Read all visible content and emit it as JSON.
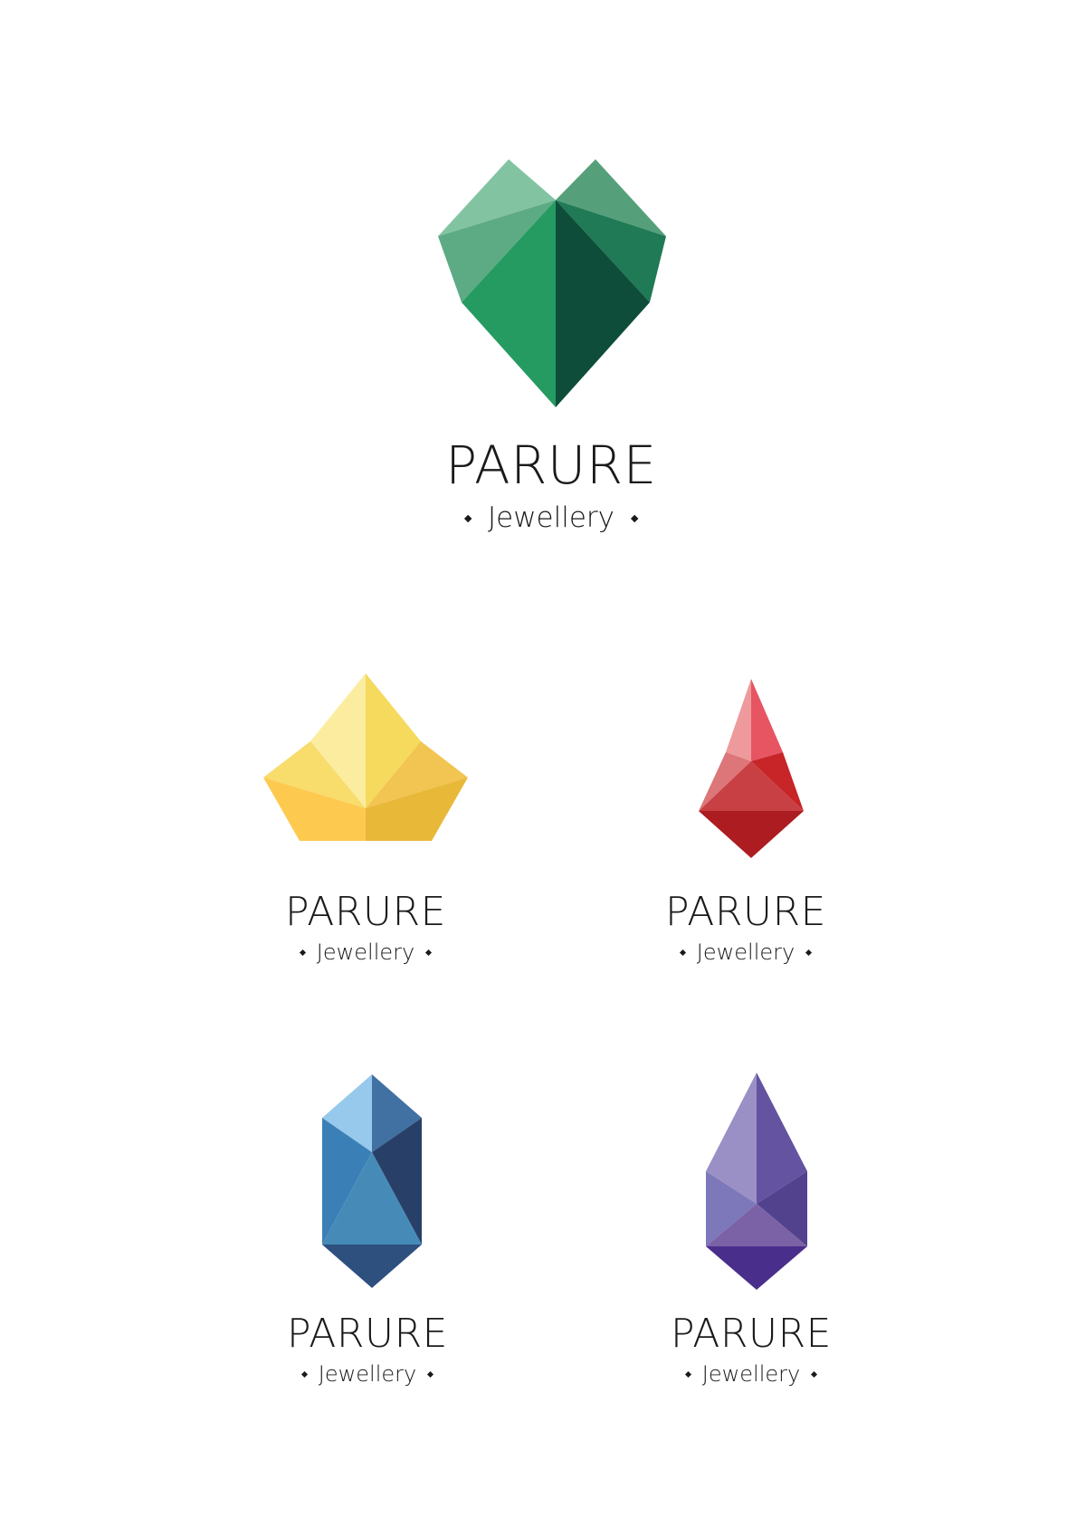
{
  "logos": [
    {
      "id": "emerald",
      "brand": "PARURE",
      "sub": "Jewellery"
    },
    {
      "id": "citrine",
      "brand": "PARURE",
      "sub": "Jewellery"
    },
    {
      "id": "ruby",
      "brand": "PARURE",
      "sub": "Jewellery"
    },
    {
      "id": "sapphire",
      "brand": "PARURE",
      "sub": "Jewellery"
    },
    {
      "id": "amethyst",
      "brand": "PARURE",
      "sub": "Jewellery"
    }
  ],
  "colors": {
    "emerald": [
      "#82c4a2",
      "#55a07a",
      "#5dab84",
      "#1f7a55",
      "#259b61",
      "#0d4d39"
    ],
    "citrine": [
      "#fcec9f",
      "#f5da5e",
      "#f8dc6c",
      "#f2c451",
      "#fdc94f",
      "#e8b838"
    ],
    "ruby": [
      "#ee9a9c",
      "#e75462",
      "#dc7679",
      "#c72528",
      "#c84044",
      "#ac1c21"
    ],
    "sapphire": [
      "#96c9ec",
      "#4171a2",
      "#3a80b7",
      "#284068",
      "#468bb8",
      "#2d507f"
    ],
    "amethyst": [
      "#9b90c5",
      "#6453a0",
      "#7c78b9",
      "#52428e",
      "#7b62a6",
      "#4a2e8c"
    ],
    "text": "#1a1a1a"
  }
}
